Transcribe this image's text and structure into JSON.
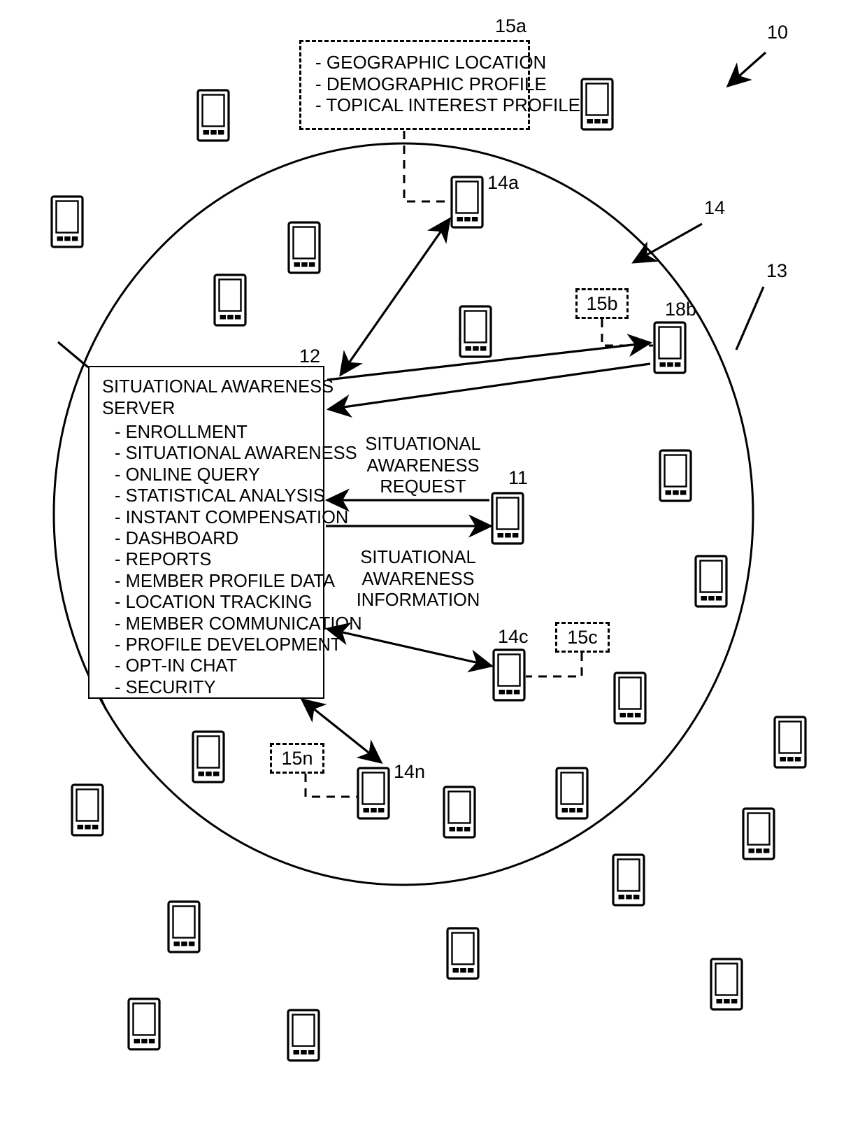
{
  "figure": {
    "type": "patent-diagram",
    "background": "#ffffff",
    "stroke": "#000000"
  },
  "reference_numerals": {
    "system": "10",
    "requesting_device": "11",
    "server": "12",
    "network_boundary": "13",
    "member_devices": "14",
    "device_a": "14a",
    "device_c": "14c",
    "device_n": "14n",
    "profile_a": "15a",
    "profile_b": "15b",
    "profile_c": "15c",
    "profile_n": "15n",
    "device_b": "18b"
  },
  "profile_box": {
    "label": "15a",
    "items": [
      "- GEOGRAPHIC LOCATION",
      "- DEMOGRAPHIC PROFILE",
      "- TOPICAL INTEREST PROFILE"
    ]
  },
  "server_box": {
    "label": "12",
    "title_line1": "SITUATIONAL AWARENESS",
    "title_line2": "SERVER",
    "functions": [
      "- ENROLLMENT",
      "- SITUATIONAL AWARENESS",
      "- ONLINE QUERY",
      "- STATISTICAL ANALYSIS",
      "- INSTANT COMPENSATION",
      "- DASHBOARD",
      "- REPORTS",
      "- MEMBER PROFILE DATA",
      "- LOCATION TRACKING",
      "- MEMBER COMMUNICATION",
      "- PROFILE DEVELOPMENT",
      "- OPT-IN CHAT",
      "- SECURITY"
    ]
  },
  "messages": {
    "request": {
      "line1": "SITUATIONAL",
      "line2": "AWARENESS",
      "line3": "REQUEST"
    },
    "information": {
      "line1": "SITUATIONAL",
      "line2": "AWARENESS",
      "line3": "INFORMATION"
    }
  },
  "small_profile_boxes": [
    {
      "label": "15b"
    },
    {
      "label": "15c"
    },
    {
      "label": "15n"
    }
  ],
  "device_labels": [
    {
      "label": "14a"
    },
    {
      "label": "18b"
    },
    {
      "label": "14c"
    },
    {
      "label": "14n"
    },
    {
      "label": "11"
    }
  ],
  "callouts": [
    {
      "label": "10"
    },
    {
      "label": "14"
    },
    {
      "label": "13"
    },
    {
      "label": "12"
    }
  ]
}
